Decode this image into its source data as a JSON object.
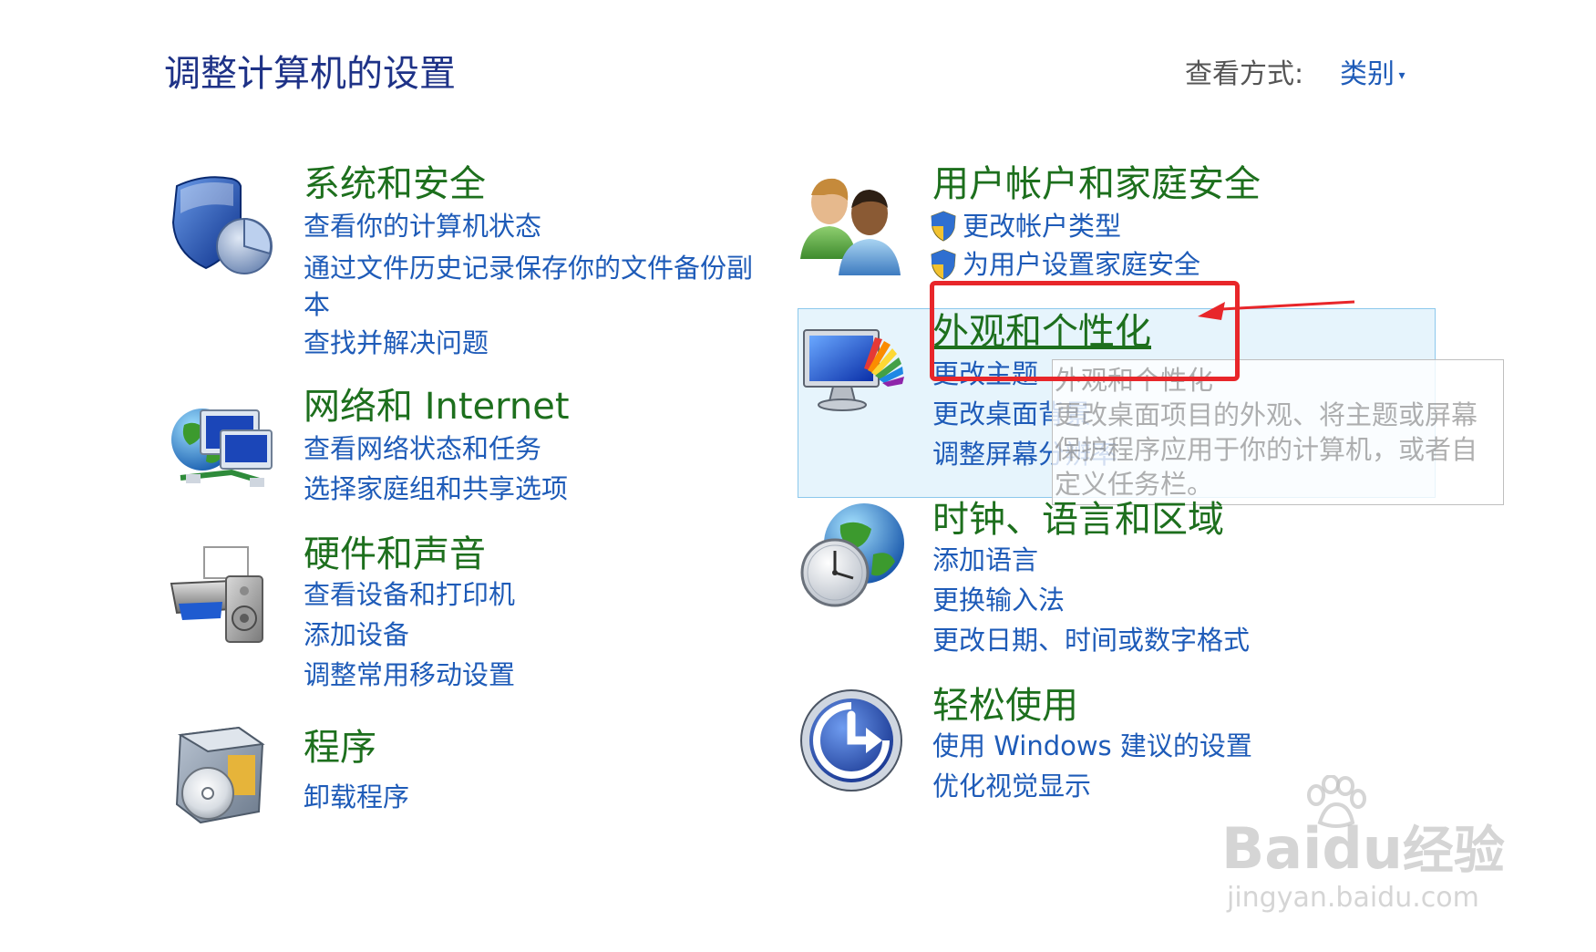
{
  "header": {
    "title": "调整计算机的设置",
    "view_by_label": "查看方式:",
    "view_by_value": "类别"
  },
  "left_categories": [
    {
      "title": "系统和安全",
      "icon": "shield-pie-icon",
      "links": [
        "查看你的计算机状态",
        "通过文件历史记录保存你的文件备份副本",
        "查找并解决问题"
      ]
    },
    {
      "title": "网络和 Internet",
      "icon": "globe-network-icon",
      "links": [
        "查看网络状态和任务",
        "选择家庭组和共享选项"
      ]
    },
    {
      "title": "硬件和声音",
      "icon": "printer-speaker-icon",
      "links": [
        "查看设备和打印机",
        "添加设备",
        "调整常用移动设置"
      ]
    },
    {
      "title": "程序",
      "icon": "program-box-disc-icon",
      "links": [
        "卸载程序"
      ]
    }
  ],
  "right_categories": [
    {
      "title": "用户帐户和家庭安全",
      "icon": "users-icon",
      "links": [
        "更改帐户类型",
        "为用户设置家庭安全"
      ]
    },
    {
      "title": "外观和个性化",
      "icon": "monitor-palette-icon",
      "links": [
        "更改主题",
        "更改桌面背景",
        "调整屏幕分辨率"
      ]
    },
    {
      "title": "时钟、语言和区域",
      "icon": "clock-globe-icon",
      "links": [
        "添加语言",
        "更换输入法",
        "更改日期、时间或数字格式"
      ]
    },
    {
      "title": "轻松使用",
      "icon": "ease-of-access-icon",
      "links": [
        "使用 Windows 建议的设置",
        "优化视觉显示"
      ]
    }
  ],
  "tooltip": {
    "title": "外观和个性化",
    "lines": [
      "更改桌面项目的外观、将主题或屏幕",
      "保护程序应用于你的计算机，或者自",
      "定义任务栏。"
    ]
  },
  "watermark": {
    "brand": "Bai",
    "brand2": "du",
    "cn": "经验",
    "url": "jingyan.baidu.com"
  },
  "colors": {
    "category_title": "#1d6f1d",
    "link": "#1e5bb8",
    "page_title": "#1e3287",
    "annotation_red": "#e8262a",
    "hover_fill": "#e6f4fc",
    "hover_border": "#8cc8ec"
  }
}
